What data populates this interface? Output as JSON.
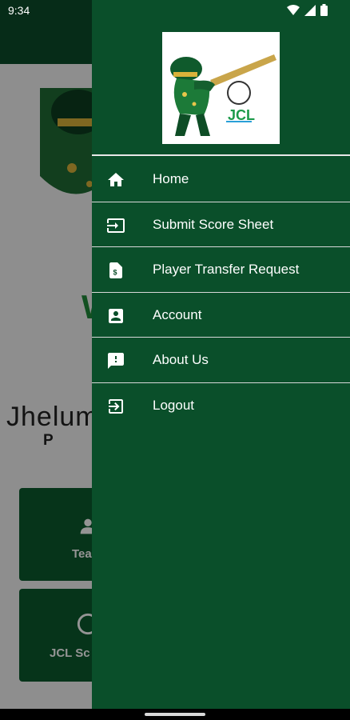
{
  "status_bar": {
    "time": "9:34"
  },
  "background": {
    "welcome_text": "W",
    "brand_text": "Jhelum",
    "brand_sub": "P  R",
    "tiles": [
      {
        "label": "Tea",
        "icon": "person-icon"
      },
      {
        "label": "JCL Sc",
        "icon": "circle-icon"
      }
    ]
  },
  "drawer": {
    "logo": {
      "text": "JCL",
      "icon": "cricket-batsman-logo"
    },
    "menu": [
      {
        "label": "Home",
        "icon": "home-icon"
      },
      {
        "label": "Submit Score Sheet",
        "icon": "input-icon"
      },
      {
        "label": "Player Transfer Request",
        "icon": "dollar-document-icon"
      },
      {
        "label": "Account",
        "icon": "account-box-icon"
      },
      {
        "label": "About Us",
        "icon": "feedback-icon"
      },
      {
        "label": "Logout",
        "icon": "logout-icon"
      }
    ]
  },
  "colors": {
    "drawer_bg": "#0a4f2a",
    "toolbar": "#0b4d2a",
    "accent": "#1f8a3a"
  }
}
